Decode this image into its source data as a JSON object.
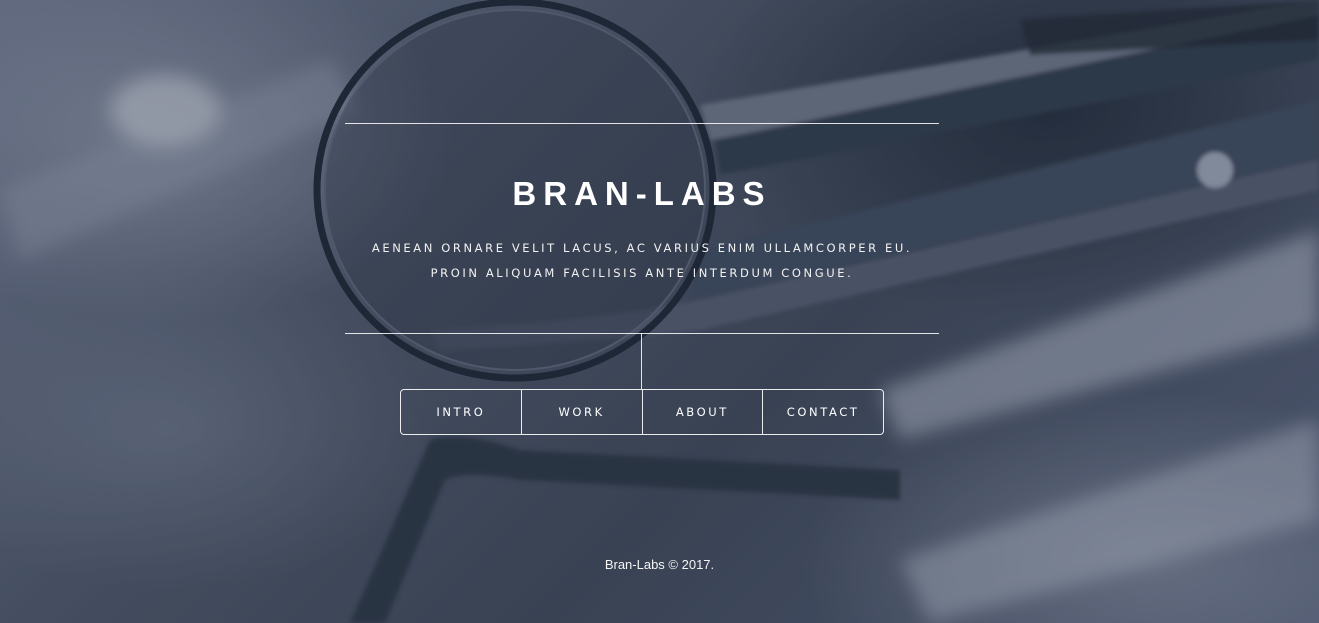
{
  "site": {
    "title": "BRAN-LABS",
    "tagline_line1": "AENEAN ORNARE VELIT LACUS, AC VARIUS ENIM ULLAMCORPER EU.",
    "tagline_line2": "PROIN ALIQUAM FACILISIS ANTE INTERDUM CONGUE."
  },
  "nav": {
    "items": [
      {
        "label": "INTRO"
      },
      {
        "label": "WORK"
      },
      {
        "label": "ABOUT"
      },
      {
        "label": "CONTACT"
      }
    ]
  },
  "footer": {
    "text": "Bran-Labs © 2017."
  },
  "background": {
    "icon": "dental-instruments-photo",
    "tint": "#3b4556"
  }
}
